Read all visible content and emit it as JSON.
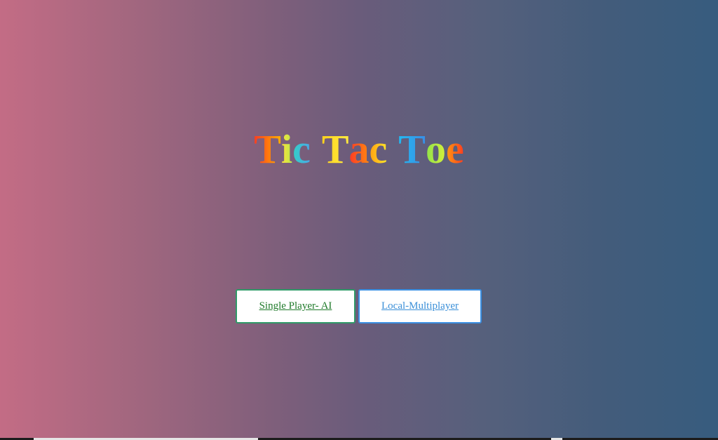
{
  "page": {
    "title_words": [
      {
        "letters": [
          {
            "char": "T",
            "style": "g-red-orange"
          },
          {
            "char": "i",
            "style": "g-yellow-green"
          },
          {
            "char": "c",
            "style": "g-teal"
          }
        ]
      },
      {
        "letters": [
          {
            "char": "T",
            "style": "g-yellow"
          },
          {
            "char": "a",
            "style": "g-red"
          },
          {
            "char": "c",
            "style": "g-orange-yel"
          }
        ]
      },
      {
        "letters": [
          {
            "char": "T",
            "style": "g-cyan-blue"
          },
          {
            "char": "o",
            "style": "g-green"
          },
          {
            "char": "e",
            "style": "g-orange-red"
          }
        ]
      }
    ]
  },
  "menu": {
    "single_player_label": "Single Player- AI",
    "local_multiplayer_label": "Local-Multiplayer"
  },
  "colors": {
    "background_left": "#c36c85",
    "background_right": "#375c7e",
    "ai_button_border": "#2f9a68",
    "ai_button_text": "#1f7a2a",
    "local_button_border": "#3a8fe2",
    "local_button_text": "#3a8fd8"
  }
}
